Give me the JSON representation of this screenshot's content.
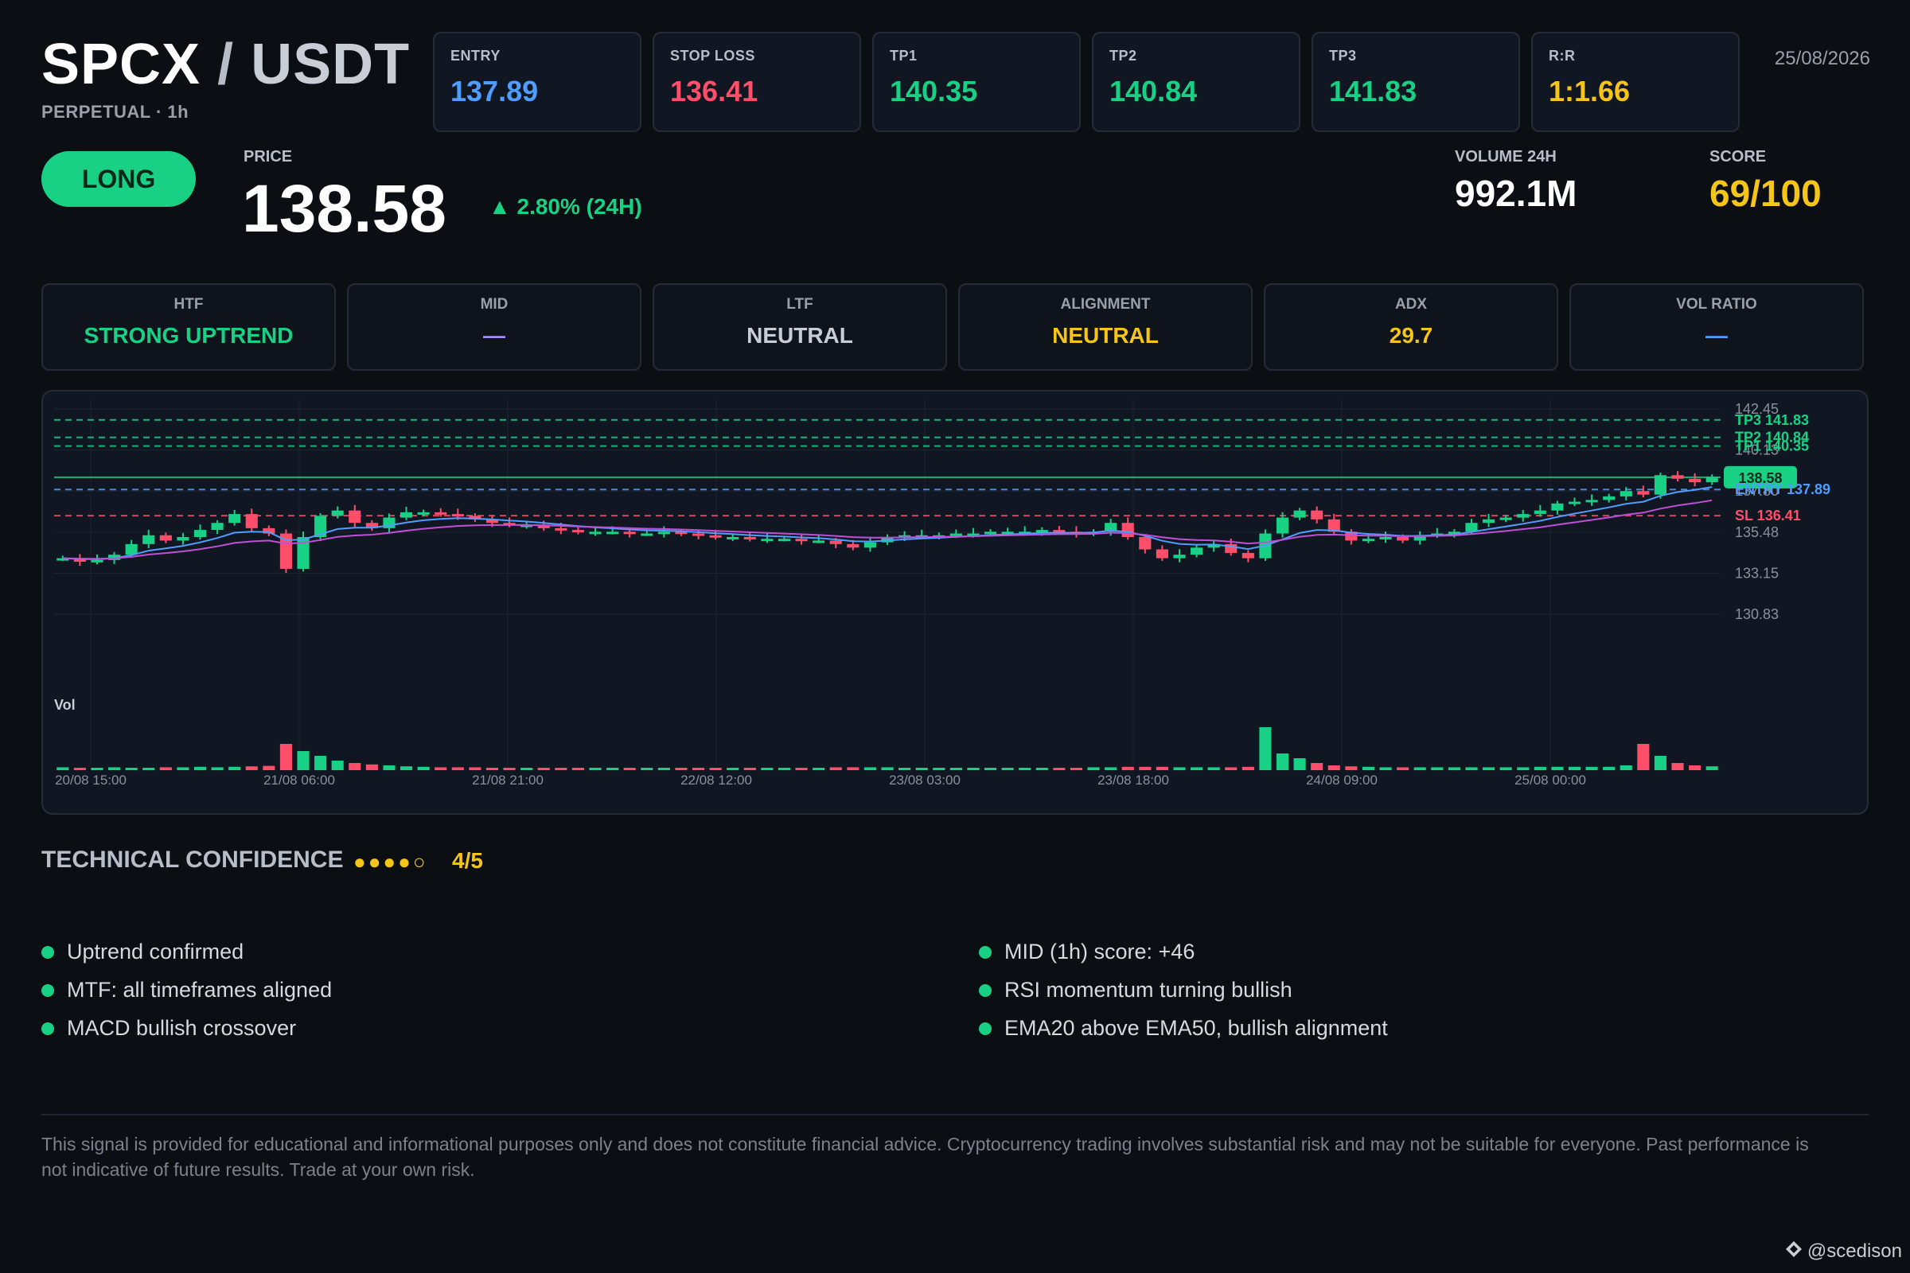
{
  "header": {
    "base": "SPCX",
    "sep": "/",
    "quote": "USDT",
    "subtitle": "PERPETUAL · 1h",
    "date": "25/08/2026"
  },
  "levels": [
    {
      "label": "ENTRY",
      "value": "137.89",
      "color": "#4f9dff"
    },
    {
      "label": "STOP LOSS",
      "value": "136.41",
      "color": "#ff4d6a"
    },
    {
      "label": "TP1",
      "value": "140.35",
      "color": "#19d184"
    },
    {
      "label": "TP2",
      "value": "140.84",
      "color": "#19d184"
    },
    {
      "label": "TP3",
      "value": "141.83",
      "color": "#19d184"
    },
    {
      "label": "R:R",
      "value": "1:1.66",
      "color": "#f5c518"
    }
  ],
  "signal": {
    "direction": "LONG",
    "price_label": "PRICE",
    "price": "138.58",
    "change": "▲ 2.80% (24H)",
    "volume_label": "VOLUME 24H",
    "volume": "992.1M",
    "score_label": "SCORE",
    "score": "69/100"
  },
  "indicators": [
    {
      "label": "HTF",
      "value": "STRONG UPTREND",
      "color": "#19d184"
    },
    {
      "label": "MID",
      "value": "—",
      "color": "#a78bfa"
    },
    {
      "label": "LTF",
      "value": "NEUTRAL",
      "color": "#c9ced6"
    },
    {
      "label": "ALIGNMENT",
      "value": "NEUTRAL",
      "color": "#f5c518"
    },
    {
      "label": "ADX",
      "value": "29.7",
      "color": "#f5c518"
    },
    {
      "label": "VOL RATIO",
      "value": "—",
      "color": "#4f9dff"
    }
  ],
  "chart_data": {
    "type": "candlestick",
    "price_axis_ticks": [
      "142.45",
      "140.13",
      "137.80",
      "135.48",
      "133.15",
      "130.83"
    ],
    "time_axis_ticks": [
      "20/08 15:00",
      "21/08 06:00",
      "21/08 21:00",
      "22/08 12:00",
      "23/08 03:00",
      "23/08 18:00",
      "24/08 09:00",
      "25/08 00:00"
    ],
    "ylim": [
      130.83,
      142.45
    ],
    "volume_label": "Vol",
    "levels": [
      {
        "name": "TP3",
        "label": "TP3 141.83",
        "value": 141.83,
        "color": "#19d184"
      },
      {
        "name": "TP2",
        "label": "TP2 140.84",
        "value": 140.84,
        "color": "#19d184"
      },
      {
        "name": "TP1",
        "label": "TP1 140.35",
        "value": 140.35,
        "color": "#19d184"
      },
      {
        "name": "PRICE",
        "label": "138.58",
        "value": 138.58,
        "color": "#19d184"
      },
      {
        "name": "ENTRY",
        "label": "ENTRY 137.89",
        "value": 137.89,
        "color": "#4f9dff"
      },
      {
        "name": "SL",
        "label": "SL 136.41",
        "value": 136.41,
        "color": "#ff4d6a"
      }
    ],
    "price_path": [
      134.0,
      133.8,
      133.9,
      134.2,
      134.8,
      135.3,
      135.0,
      135.2,
      135.6,
      136.0,
      136.5,
      135.7,
      135.4,
      133.4,
      135.2,
      136.4,
      136.7,
      136.0,
      135.7,
      136.3,
      136.6,
      136.6,
      136.5,
      136.4,
      136.2,
      136.0,
      135.9,
      135.9,
      135.7,
      135.6,
      135.5,
      135.5,
      135.5,
      135.4,
      135.4,
      135.5,
      135.4,
      135.3,
      135.2,
      135.2,
      135.1,
      135.1,
      135.1,
      135.0,
      135.0,
      134.8,
      134.6,
      134.9,
      135.2,
      135.3,
      135.3,
      135.3,
      135.4,
      135.4,
      135.5,
      135.5,
      135.5,
      135.6,
      135.5,
      135.4,
      135.5,
      136.0,
      135.2,
      134.5,
      134.0,
      134.2,
      134.6,
      134.8,
      134.3,
      134.0,
      135.4,
      136.3,
      136.7,
      136.2,
      135.5,
      135.0,
      135.1,
      135.2,
      135.0,
      135.3,
      135.4,
      135.5,
      136.0,
      136.2,
      136.3,
      136.5,
      136.7,
      137.1,
      137.2,
      137.3,
      137.5,
      137.8,
      137.6,
      138.7,
      138.5,
      138.3,
      138.6
    ],
    "volume_path": [
      0.06,
      0.05,
      0.05,
      0.06,
      0.05,
      0.05,
      0.06,
      0.06,
      0.07,
      0.06,
      0.07,
      0.08,
      0.09,
      0.55,
      0.4,
      0.3,
      0.2,
      0.15,
      0.12,
      0.1,
      0.08,
      0.07,
      0.06,
      0.06,
      0.06,
      0.05,
      0.05,
      0.05,
      0.05,
      0.05,
      0.05,
      0.05,
      0.05,
      0.05,
      0.05,
      0.05,
      0.05,
      0.05,
      0.05,
      0.05,
      0.05,
      0.05,
      0.05,
      0.05,
      0.05,
      0.06,
      0.06,
      0.06,
      0.06,
      0.05,
      0.05,
      0.05,
      0.05,
      0.05,
      0.05,
      0.05,
      0.05,
      0.05,
      0.05,
      0.05,
      0.06,
      0.06,
      0.07,
      0.07,
      0.07,
      0.06,
      0.06,
      0.06,
      0.06,
      0.07,
      0.9,
      0.35,
      0.25,
      0.15,
      0.1,
      0.08,
      0.07,
      0.06,
      0.06,
      0.06,
      0.06,
      0.06,
      0.06,
      0.06,
      0.06,
      0.06,
      0.07,
      0.07,
      0.07,
      0.07,
      0.07,
      0.1,
      0.55,
      0.3,
      0.15,
      0.1,
      0.08
    ]
  },
  "confidence": {
    "title": "TECHNICAL CONFIDENCE",
    "dots": "●●●●○",
    "score": "4/5"
  },
  "reasons_left": [
    "Uptrend confirmed",
    "MTF: all timeframes aligned",
    "MACD bullish crossover"
  ],
  "reasons_right": [
    "MID (1h) score: +46",
    "RSI momentum turning bullish",
    "EMA20 above EMA50, bullish alignment"
  ],
  "disclaimer": "This signal is provided for educational and informational purposes only and does not constitute financial advice. Cryptocurrency trading involves substantial risk and may not be suitable for everyone. Past performance is not indicative of future results. Trade at your own risk.",
  "watermark": "@scedison"
}
